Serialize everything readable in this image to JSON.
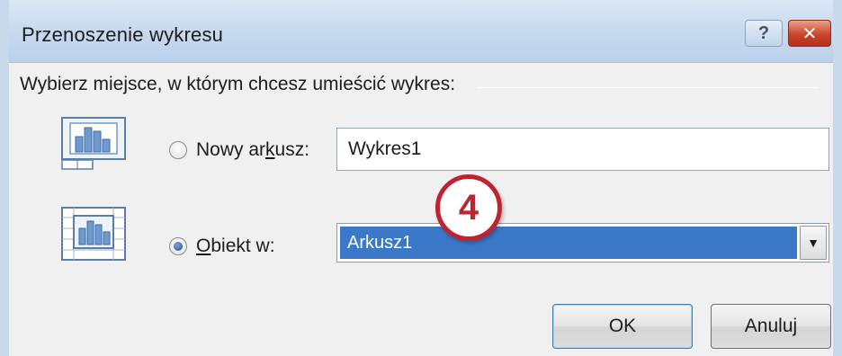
{
  "window": {
    "title": "Przenoszenie wykresu",
    "help_label": "?",
    "close_label": "✕"
  },
  "instruction": "Wybierz miejsce, w którym chcesz umieścić wykres:",
  "options": {
    "new_sheet": {
      "label_pre": "Nowy ar",
      "label_accel": "k",
      "label_post": "usz:",
      "selected": false,
      "value": "Wykres1"
    },
    "object_in": {
      "label_pre": "",
      "label_accel": "O",
      "label_post": "biekt w:",
      "selected": true,
      "value": "Arkusz1"
    }
  },
  "step_badge": "4",
  "buttons": {
    "ok": "OK",
    "cancel": "Anuluj"
  },
  "icons": {
    "new_sheet": "chart-sheet-icon",
    "object_in": "embedded-chart-icon",
    "dropdown": "dropdown-arrow-icon"
  },
  "colors": {
    "selection": "#3c78c8",
    "badge": "#c0222e",
    "close": "#c9452b",
    "titlebar": "#c6d8ee"
  }
}
